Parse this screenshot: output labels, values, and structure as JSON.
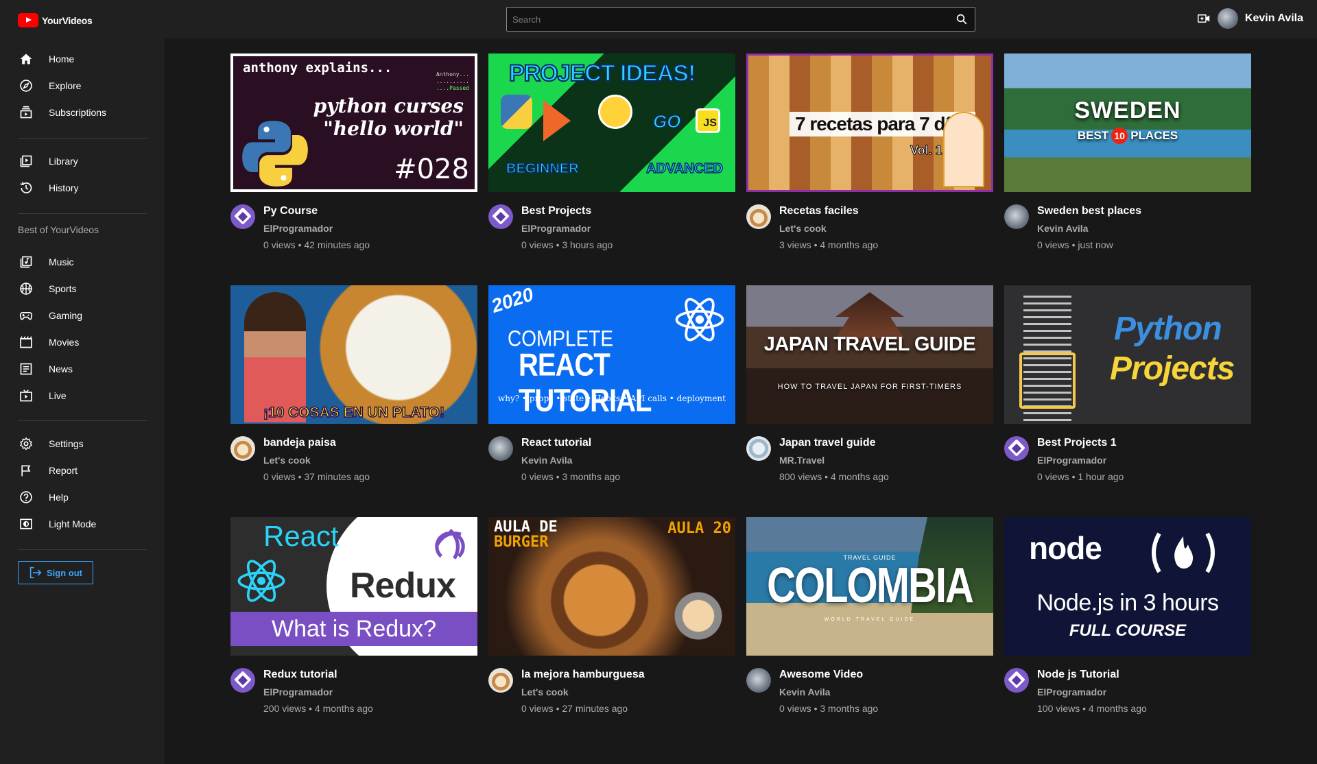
{
  "app": {
    "name": "YourVideos"
  },
  "search": {
    "placeholder": "Search"
  },
  "user": {
    "name": "Kevin Avila"
  },
  "sidebar": {
    "main": [
      {
        "label": "Home",
        "icon": "home-icon"
      },
      {
        "label": "Explore",
        "icon": "compass-icon"
      },
      {
        "label": "Subscriptions",
        "icon": "subscriptions-icon"
      }
    ],
    "library": [
      {
        "label": "Library",
        "icon": "library-icon"
      },
      {
        "label": "History",
        "icon": "history-icon"
      }
    ],
    "best_title": "Best of YourVideos",
    "best": [
      {
        "label": "Music",
        "icon": "music-icon"
      },
      {
        "label": "Sports",
        "icon": "sports-icon"
      },
      {
        "label": "Gaming",
        "icon": "gaming-icon"
      },
      {
        "label": "Movies",
        "icon": "movies-icon"
      },
      {
        "label": "News",
        "icon": "news-icon"
      },
      {
        "label": "Live",
        "icon": "live-icon"
      }
    ],
    "settings": [
      {
        "label": "Settings",
        "icon": "gear-icon"
      },
      {
        "label": "Report",
        "icon": "flag-icon"
      },
      {
        "label": "Help",
        "icon": "help-icon"
      },
      {
        "label": "Light Mode",
        "icon": "light-mode-icon"
      }
    ],
    "signout_label": "Sign out"
  },
  "videos": [
    {
      "title": "Py Course",
      "channel": "ElProgramador",
      "stats": "0 views • 42 minutes ago",
      "thumb": {
        "line1": "anthony explains...",
        "corner1": "Anthony...",
        "corner2": "..........",
        "corner3": "....Passed",
        "line2": "python curses",
        "line3": "\"hello world\"",
        "line4": "#028"
      }
    },
    {
      "title": "Best Projects",
      "channel": "ElProgramador",
      "stats": "0 views • 3 hours ago",
      "thumb": {
        "line1": "PROJECT IDEAS!",
        "line2": "BEGINNER",
        "line3": "ADVANCED",
        "line4": "GO",
        "line5": "JS"
      }
    },
    {
      "title": "Recetas faciles",
      "channel": "Let's cook",
      "stats": "3 views • 4 months ago",
      "thumb": {
        "line1": "7 recetas para 7 días",
        "line2": "Vol. 1"
      }
    },
    {
      "title": "Sweden best places",
      "channel": "Kevin Avila",
      "stats": "0 views • just now",
      "thumb": {
        "line1": "SWEDEN",
        "line2": "BEST",
        "line3": "10",
        "line4": "PLACES"
      }
    },
    {
      "title": "bandeja paisa",
      "channel": "Let's cook",
      "stats": "0 views • 37 minutes ago",
      "thumb": {
        "line1": "¡10 COSAS EN UN PLATO!"
      }
    },
    {
      "title": "React tutorial",
      "channel": "Kevin Avila",
      "stats": "0 views • 3 months ago",
      "thumb": {
        "line1": "2020",
        "line2": "COMPLETE",
        "line3": "REACT TUTORIAL",
        "line4": "why? • props • state • Hooks • API calls • deployment"
      }
    },
    {
      "title": "Japan travel guide",
      "channel": "MR.Travel",
      "stats": "800 views • 4 months ago",
      "thumb": {
        "line1": "JAPAN TRAVEL GUIDE",
        "line2": "HOW TO TRAVEL JAPAN FOR FIRST-TIMERS"
      }
    },
    {
      "title": "Best Projects 1",
      "channel": "ElProgramador",
      "stats": "0 views • 1 hour ago",
      "thumb": {
        "line1": "Python",
        "line2": "Projects"
      }
    },
    {
      "title": "Redux tutorial",
      "channel": "ElProgramador",
      "stats": "200 views • 4 months ago",
      "thumb": {
        "line1": "React",
        "line2": "Redux",
        "line3": "What is Redux?"
      }
    },
    {
      "title": "la mejora hamburguesa",
      "channel": "Let's cook",
      "stats": "0 views • 27 minutes ago",
      "thumb": {
        "line1": "AULA DE",
        "line2": "BURGER",
        "line3": "AULA 20"
      }
    },
    {
      "title": "Awesome Video",
      "channel": "Kevin Avila",
      "stats": "0 views • 3 months ago",
      "thumb": {
        "line1": "TRAVEL GUIDE",
        "line2": "COLOMBIA",
        "line3": "WORLD TRAVEL GUIDE"
      }
    },
    {
      "title": "Node js Tutorial",
      "channel": "ElProgramador",
      "stats": "100 views • 4 months ago",
      "thumb": {
        "line1": "node",
        "line2": "Node.js in 3 hours",
        "line3": "FULL COURSE"
      }
    }
  ],
  "colors": {
    "accent": "#3ea6ff",
    "brand": "#ff0000",
    "header_bg": "#202020",
    "page_bg": "#181818"
  }
}
